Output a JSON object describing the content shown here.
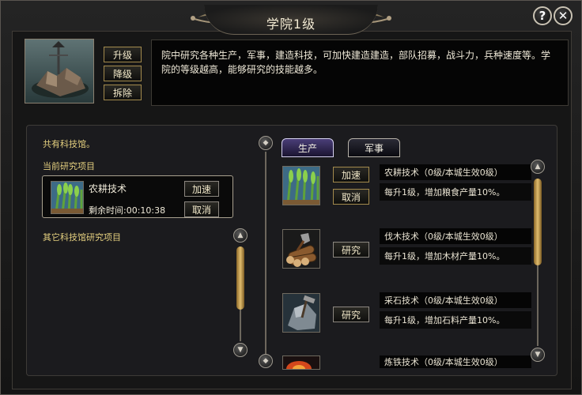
{
  "window": {
    "title": "学院1级"
  },
  "header_buttons": {
    "help": "?",
    "close": "✕"
  },
  "building": {
    "actions": {
      "upgrade": "升级",
      "downgrade": "降级",
      "demolish": "拆除"
    },
    "description": "院中研究各种生产，军事，建造科技，可加快建造建造，部队招募，战斗力，兵种速度等。学院的等级越高，能够研究的技能越多。"
  },
  "left": {
    "shared_label": "共有科技馆。",
    "current_label": "当前研究项目",
    "current": {
      "name": "农耕技术",
      "remaining": "剩余时间:00:10:38",
      "speedup": "加速",
      "cancel": "取消"
    },
    "others_label": "其它科技馆研究项目"
  },
  "tabs": [
    {
      "label": "生产"
    },
    {
      "label": "军事"
    }
  ],
  "tech_list": [
    {
      "title": "农耕技术（0级/本城生效0级）",
      "effect": "每升1级，增加粮食产量10%。",
      "btn1": "加速",
      "btn2": "取消",
      "icon": "wheat-icon"
    },
    {
      "title": "伐木技术（0级/本城生效0级）",
      "effect": "每升1级，增加木材产量10%。",
      "btn1": "研究",
      "icon": "logs-icon"
    },
    {
      "title": "采石技术（0级/本城生效0级）",
      "effect": "每升1级，增加石料产量10%。",
      "btn1": "研究",
      "icon": "stone-icon"
    },
    {
      "title": "炼铁技术（0级/本城生效0级）",
      "icon": "iron-icon"
    }
  ],
  "colors": {
    "gold": "#e4cf7f",
    "accent_tab": "#4a3e78",
    "scroll": "#e0bd6e"
  }
}
